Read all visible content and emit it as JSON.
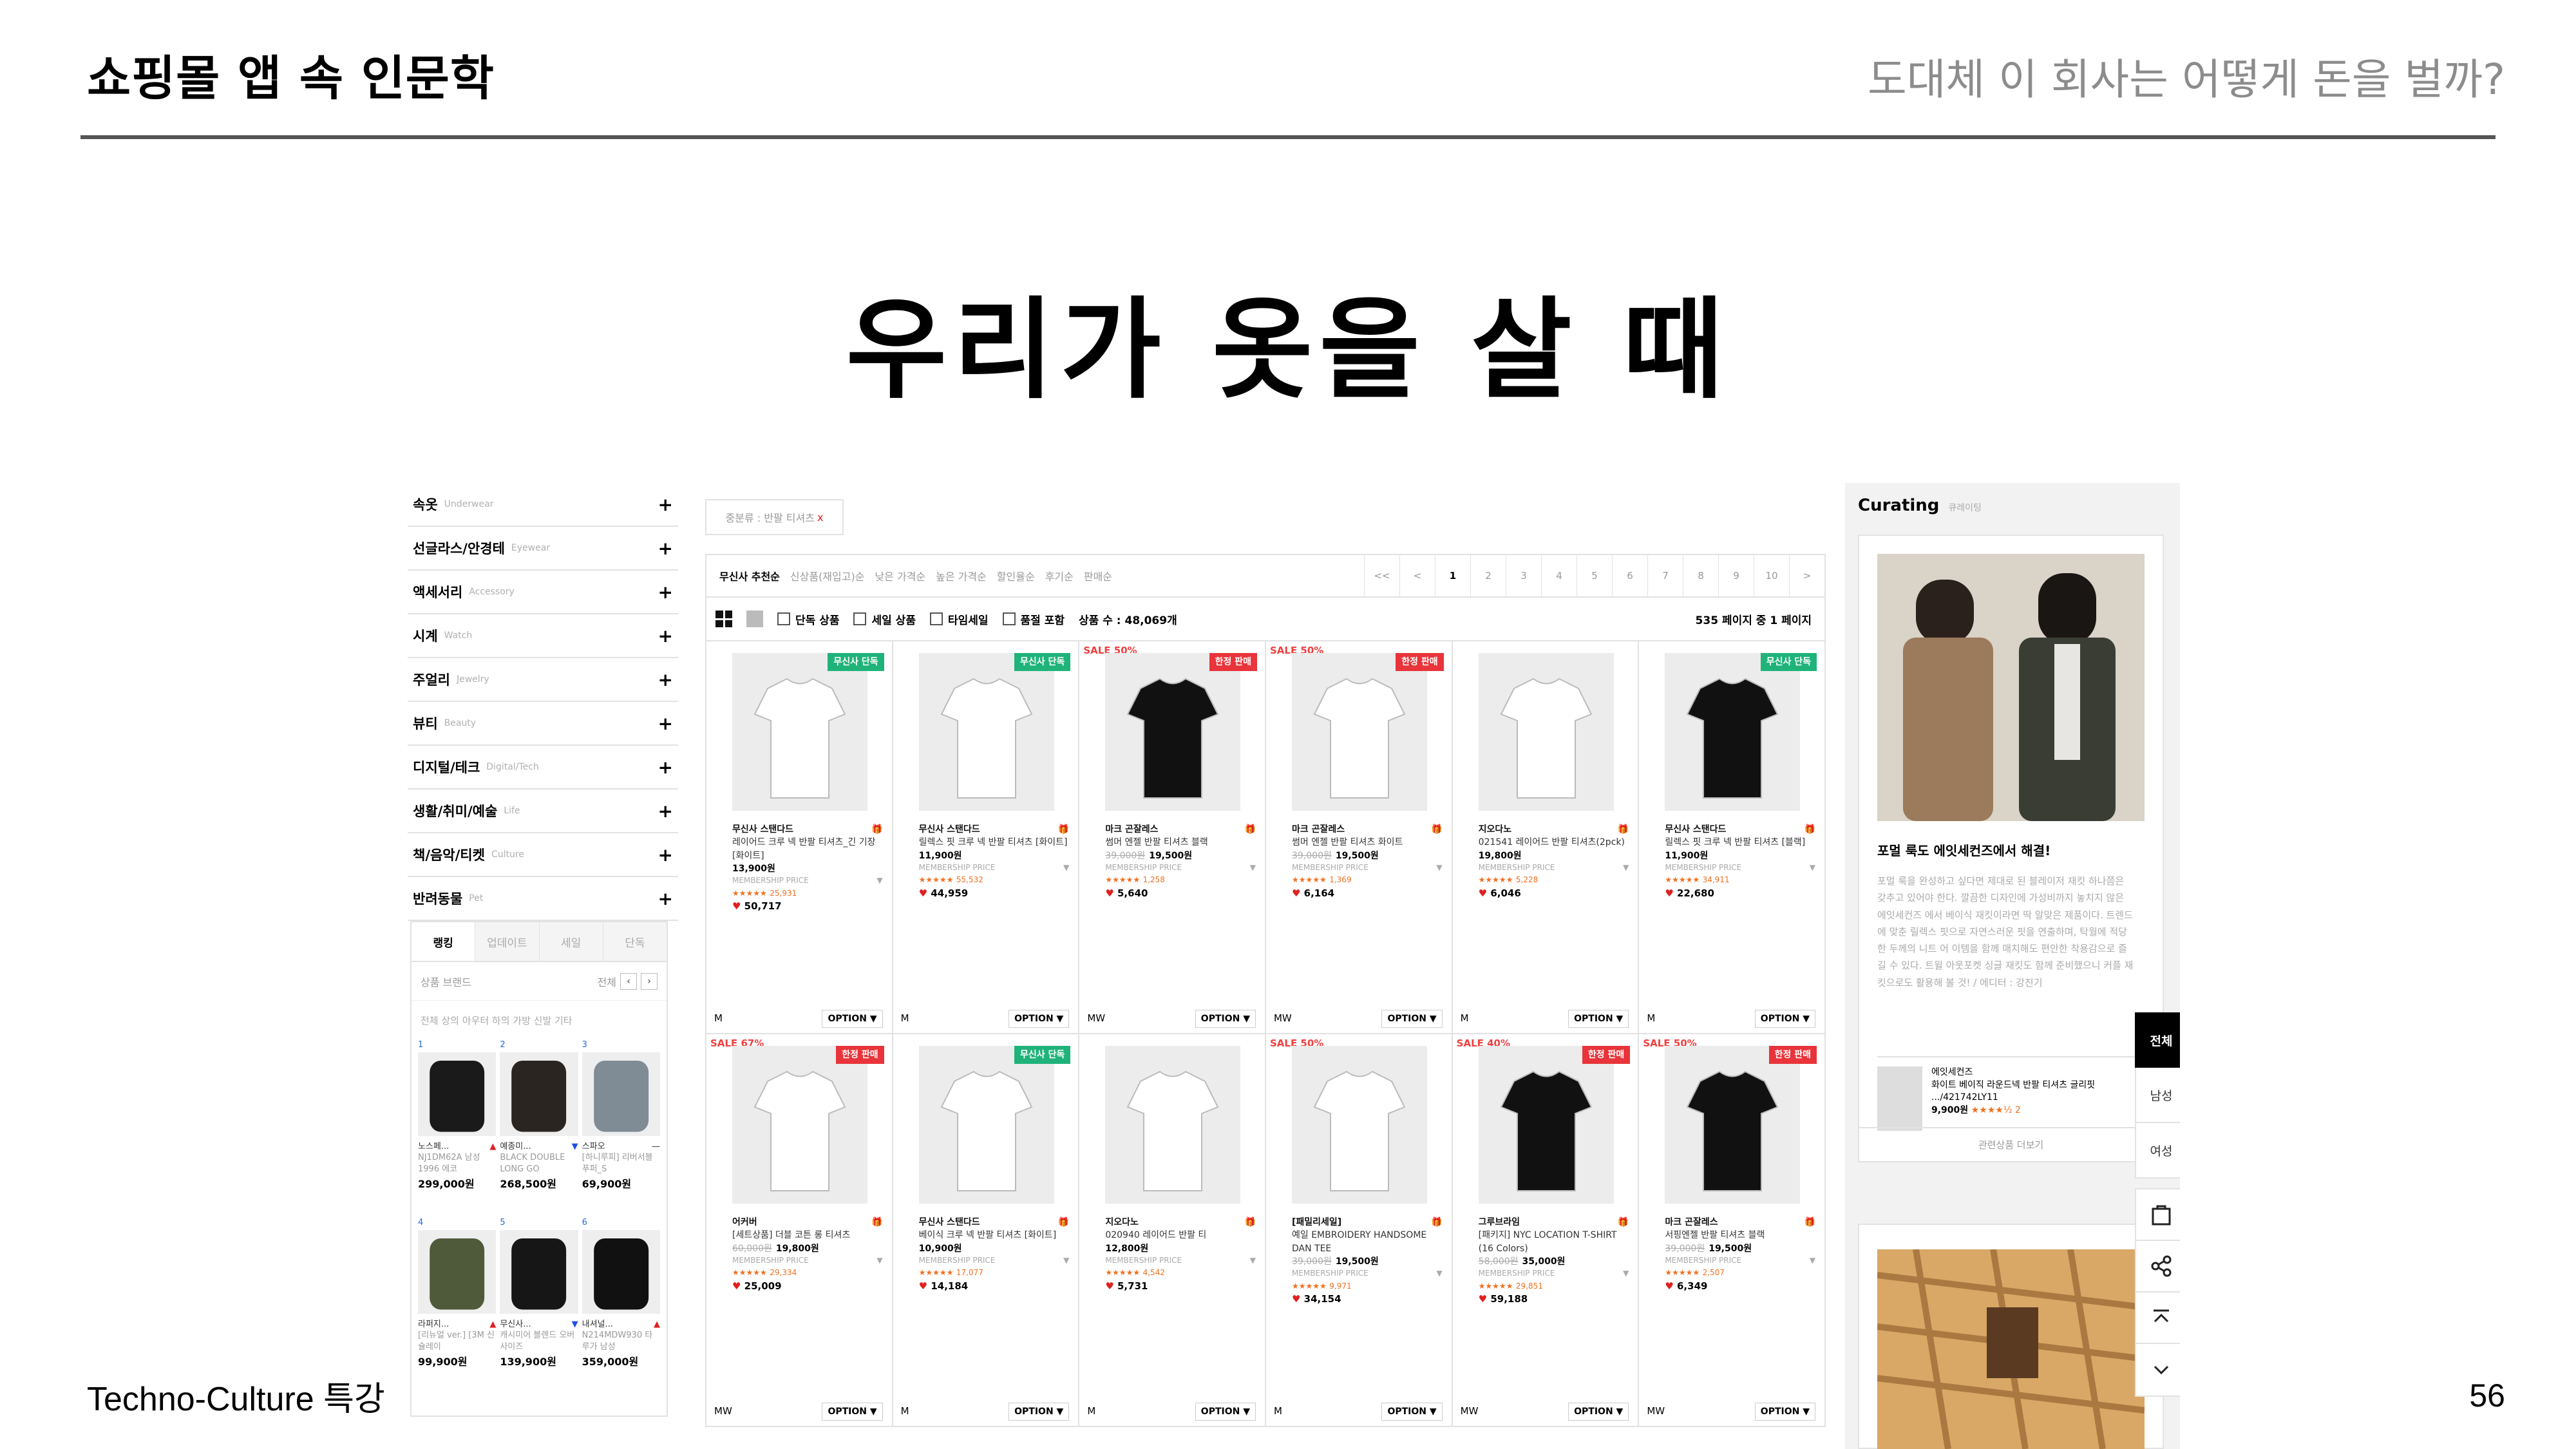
{
  "slide": {
    "title": "쇼핑몰 앱 속 인문학",
    "subtitle": "도대체 이 회사는 어떻게 돈을 벌까?",
    "headline": "우리가 옷을 살 때",
    "footer": "Techno-Culture 특강",
    "page_number": "56"
  },
  "categories": [
    {
      "ko": "속옷",
      "en": "Underwear"
    },
    {
      "ko": "선글라스/안경테",
      "en": "Eyewear"
    },
    {
      "ko": "액세서리",
      "en": "Accessory"
    },
    {
      "ko": "시계",
      "en": "Watch"
    },
    {
      "ko": "주얼리",
      "en": "Jewelry"
    },
    {
      "ko": "뷰티",
      "en": "Beauty"
    },
    {
      "ko": "디지털/테크",
      "en": "Digital/Tech"
    },
    {
      "ko": "생활/취미/예술",
      "en": "Life"
    },
    {
      "ko": "책/음악/티켓",
      "en": "Culture"
    },
    {
      "ko": "반려동물",
      "en": "Pet"
    }
  ],
  "ranking": {
    "tabs": [
      "랭킹",
      "업데이트",
      "세일",
      "단독"
    ],
    "row1_left": "상품 브랜드",
    "row1_right": "전체",
    "row2": "전체 상의 아우터 하의 가방 신발 기타",
    "items": [
      {
        "num": "1",
        "name": "노스페...",
        "trend": "▲",
        "desc": "NJ1DM62A 남성 1996 에코",
        "price": "299,000원",
        "color": "#1a1a1a"
      },
      {
        "num": "2",
        "name": "예종미...",
        "trend": "▼",
        "desc": "BLACK DOUBLE LONG GO",
        "price": "268,500원",
        "color": "#2b2522"
      },
      {
        "num": "3",
        "name": "스파오",
        "trend": "—",
        "desc": "[하니루피] 리버서블 푸퍼_S",
        "price": "69,900원",
        "color": "#7f8b95"
      },
      {
        "num": "4",
        "name": "라퍼지...",
        "trend": "▲",
        "desc": "[리뉴얼 ver.] [3M 신슐레이",
        "price": "99,900원",
        "color": "#4f5a3a"
      },
      {
        "num": "5",
        "name": "무신사...",
        "trend": "▼",
        "desc": "캐시미어 블렌드 오버사이즈",
        "price": "139,900원",
        "color": "#161616"
      },
      {
        "num": "6",
        "name": "내셔널...",
        "trend": "▲",
        "desc": "N214MDW930 타루가 남성",
        "price": "359,000원",
        "color": "#111111"
      }
    ]
  },
  "breadcrumb": "중분류 : 반팔 티셔츠",
  "sort": {
    "options": [
      "무신사 추천순",
      "신상품(재입고)순",
      "낮은 가격순",
      "높은 가격순",
      "할인율순",
      "후기순",
      "판매순"
    ],
    "pages": [
      "<<",
      "<",
      "1",
      "2",
      "3",
      "4",
      "5",
      "6",
      "7",
      "8",
      "9",
      "10",
      ">"
    ]
  },
  "filters": {
    "checks": [
      "단독 상품",
      "세일 상품",
      "타임세일",
      "품절 포함"
    ],
    "count": "상품 수 : 48,069개",
    "page_info": "535 페이지 중 1 페이지"
  },
  "products": [
    {
      "sale": "",
      "badge": "무신사 단독",
      "badge_color": "g",
      "tee": "#ffffff",
      "brand": "무신사 스탠다드",
      "name": "레이어드 크루 넥 반팔 티셔츠_긴 기장 [화이트]",
      "orig": "",
      "price": "13,900원",
      "stars": "★★★★★",
      "reviews": "25,931",
      "likes": "50,717",
      "tag": "M"
    },
    {
      "sale": "",
      "badge": "무신사 단독",
      "badge_color": "g",
      "tee": "#ffffff",
      "brand": "무신사 스탠다드",
      "name": "릴렉스 핏 크루 넥 반팔 티셔츠 [화이트]",
      "orig": "",
      "price": "11,900원",
      "stars": "★★★★★",
      "reviews": "55,532",
      "likes": "44,959",
      "tag": "M"
    },
    {
      "sale": "SALE 50%",
      "badge": "한정 판매",
      "badge_color": "r",
      "tee": "#111111",
      "brand": "마크 곤잘레스",
      "name": "썸머 엔젤 반팔 티셔츠 블랙",
      "orig": "39,000원",
      "price": "19,500원",
      "stars": "★★★★★",
      "reviews": "1,258",
      "likes": "5,640",
      "tag": "MW"
    },
    {
      "sale": "SALE 50%",
      "badge": "한정 판매",
      "badge_color": "r",
      "tee": "#ffffff",
      "brand": "마크 곤잘레스",
      "name": "썸머 엔젤 반팔 티셔츠 화이트",
      "orig": "39,000원",
      "price": "19,500원",
      "stars": "★★★★★",
      "reviews": "1,369",
      "likes": "6,164",
      "tag": "MW"
    },
    {
      "sale": "",
      "badge": "",
      "badge_color": "",
      "tee": "#ffffff",
      "brand": "지오다노",
      "name": "021541 레이어드 반팔 티셔츠(2pck)",
      "orig": "",
      "price": "19,800원",
      "stars": "★★★★★",
      "reviews": "5,228",
      "likes": "6,046",
      "tag": "M"
    },
    {
      "sale": "",
      "badge": "무신사 단독",
      "badge_color": "g",
      "tee": "#111111",
      "brand": "무신사 스탠다드",
      "name": "릴렉스 핏 크루 넥 반팔 티셔츠 [블랙]",
      "orig": "",
      "price": "11,900원",
      "stars": "★★★★★",
      "reviews": "34,911",
      "likes": "22,680",
      "tag": "M"
    },
    {
      "sale": "SALE 67%",
      "badge": "한정 판매",
      "badge_color": "r",
      "tee": "#ffffff",
      "brand": "어커버",
      "name": "[세트상품] 더블 코튼 롱 티셔츠",
      "orig": "60,000원",
      "price": "19,800원",
      "stars": "★★★★★",
      "reviews": "29,334",
      "likes": "25,009",
      "tag": "MW"
    },
    {
      "sale": "",
      "badge": "무신사 단독",
      "badge_color": "g",
      "tee": "#ffffff",
      "brand": "무신사 스탠다드",
      "name": "베이식 크루 넥 반팔 티셔츠 [화이트]",
      "orig": "",
      "price": "10,900원",
      "stars": "★★★★★",
      "reviews": "17,077",
      "likes": "14,184",
      "tag": "M"
    },
    {
      "sale": "",
      "badge": "",
      "badge_color": "",
      "tee": "#ffffff",
      "brand": "지오다노",
      "name": "020940 레이어드 반팔 티",
      "orig": "",
      "price": "12,800원",
      "stars": "★★★★★",
      "reviews": "4,542",
      "likes": "5,731",
      "tag": "M"
    },
    {
      "sale": "SALE 50%",
      "badge": "",
      "badge_color": "",
      "tee": "#ffffff",
      "brand": "[패밀리세일]",
      "name": "예일 EMBROIDERY HANDSOME DAN TEE",
      "orig": "39,000원",
      "price": "19,500원",
      "stars": "★★★★★",
      "reviews": "9,971",
      "likes": "34,154",
      "tag": "M"
    },
    {
      "sale": "SALE 40%",
      "badge": "한정 판매",
      "badge_color": "r",
      "tee": "#111111",
      "brand": "그루브라임",
      "name": "[패키지] NYC LOCATION T-SHIRT (16 Colors)",
      "orig": "58,000원",
      "price": "35,000원",
      "stars": "★★★★★",
      "reviews": "29,851",
      "likes": "59,188",
      "tag": "MW"
    },
    {
      "sale": "SALE 50%",
      "badge": "한정 판매",
      "badge_color": "r",
      "tee": "#111111",
      "brand": "마크 곤잘레스",
      "name": "서핑엔젤 반팔 티셔츠 블랙",
      "orig": "39,000원",
      "price": "19,500원",
      "stars": "★★★★★",
      "reviews": "2,507",
      "likes": "6,349",
      "tag": "MW"
    }
  ],
  "common": {
    "membership": "MEMBERSHIP PRICE",
    "option": "OPTION ▼",
    "gift": "🎁"
  },
  "curating": {
    "title": "Curating",
    "title_ko": "큐레이팅",
    "headline": "포멀 룩도 에잇세컨즈에서 해결!",
    "body": "포멀 룩을 완성하고 싶다면 제대로 된 블레이저 재킷 하나쯤은 갖추고 있어야 한다. 깔끔한 디자인에 가성비까지 놓치지 않은 에잇세컨즈 에서 베이식 재킷이라면 딱 알맞은 제품이다. 트렌드에 맞춘 릴렉스 핏으로 자연스러운 핏을 연출하며, 탁월에 적당한 두께의 니트 어 이템을 함께 매치해도 편안한 착용감으로 즐길 수 있다. 트윌 아웃포켓 싱글 재킷도 함께 준비했으니 커플 재킷으로도 활용해 볼 것! / 에디터 : 강진기",
    "item_brand": "에잇세컨즈",
    "item_name": "화이트 베이직 라운드넥 반팔 티셔츠 글리핏 .../421742LY11",
    "item_price": "9,900원",
    "item_stars": "★★★★½",
    "item_reviews": "2",
    "more": "관련상품 더보기"
  },
  "side_tabs": [
    "전체",
    "남성",
    "여성"
  ],
  "side_tools": [
    "bag-icon",
    "share-icon",
    "scroll-top-icon",
    "scroll-down-icon"
  ]
}
